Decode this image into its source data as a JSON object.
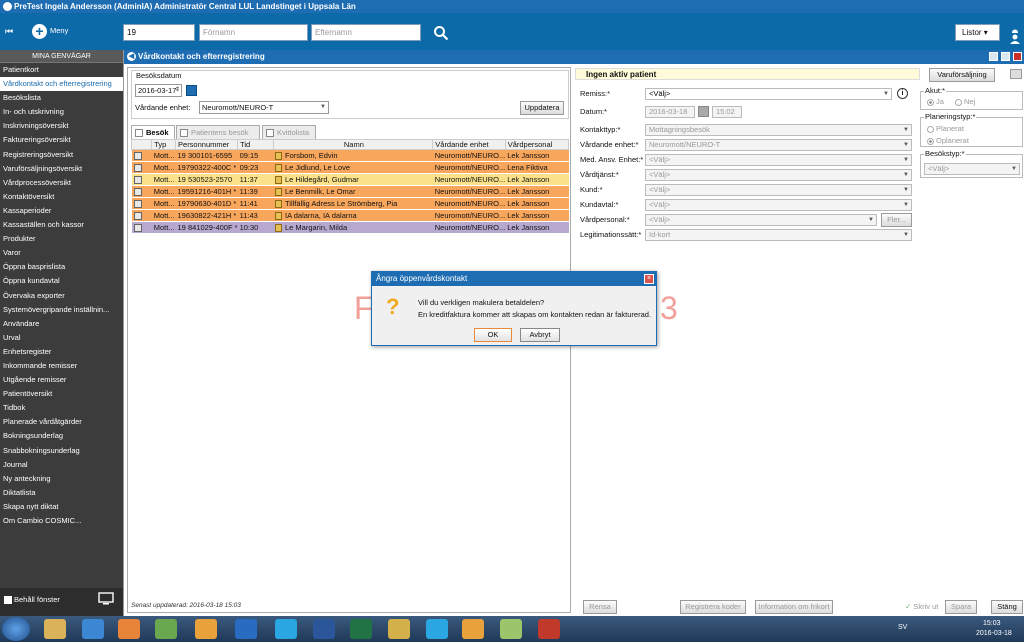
{
  "window_title": "PreTest Ingela Andersson (AdminIA) Administratör Central LUL Landstinget i Uppsala Län",
  "header": {
    "menu_label": "Meny",
    "search_value": "19",
    "firstname_placeholder": "Förnamn",
    "lastname_placeholder": "Efternamn",
    "lists_label": "Listor"
  },
  "sidebar": {
    "title": "MINA GENVÄGAR",
    "items": [
      "Patientkort",
      "Vårdkontakt och efterregistrering",
      "Besökslista",
      "In- och utskrivning",
      "Inskrivningsöversikt",
      "Faktureringsöversikt",
      "Registreringsöversikt",
      "Varuförsäljningsöversikt",
      "Vårdprocessöversikt",
      "Kontaktöversikt",
      "Kassaperioder",
      "Kassaställen och kassor",
      "Produkter",
      "Varor",
      "Öppna basprislista",
      "Öppna kundavtal",
      "Övervaka exporter",
      "Systemövergripande inställnin...",
      "Användare",
      "Urval",
      "Enhetsregister",
      "Inkommande remisser",
      "Utgående remisser",
      "Patientöversikt",
      "Tidbok",
      "Planerade vårdåtgärder",
      "Bokningsunderlag",
      "Snabbokningsunderlag",
      "Journal",
      "Ny anteckning",
      "Diktatlista",
      "Skapa nytt diktat",
      "Om Cambio COSMIC..."
    ],
    "active_index": 1,
    "keep_window_label": "Behåll fönster"
  },
  "main": {
    "title": "Vårdkontakt och efterregistrering",
    "besok_group_label": "Besöksdatum",
    "date_value": "2016-03-17",
    "unit_label": "Vårdande enhet:",
    "unit_value": "Neuromott/NEURO-T",
    "update_button": "Uppdatera",
    "tabs": [
      "Besök",
      "Patientens besök",
      "Kvittolista"
    ],
    "columns": [
      "Typ",
      "Personnummer",
      "Tid",
      "Namn",
      "Vårdande enhet",
      "Vårdpersonal"
    ],
    "rows": [
      {
        "typ": "Mott...",
        "pnr": "19 300101-6595",
        "tid": "09:15",
        "namn": "Forsbom, Edvin",
        "enhet": "Neuromott/NEURO...",
        "personal": "Lek Jansson",
        "color": "orange"
      },
      {
        "typ": "Mott...",
        "pnr": "19790322-400C *",
        "tid": "09:23",
        "namn": "Le Jidlund, Le Love",
        "enhet": "Neuromott/NEURO...",
        "personal": "Lena Fiktiva",
        "color": "orange"
      },
      {
        "typ": "Mott...",
        "pnr": "19 530523-2570",
        "tid": "11:37",
        "namn": "Le Hildegård, Gudmar",
        "enhet": "Neuromott/NEURO...",
        "personal": "Lek Jansson",
        "color": "yellow"
      },
      {
        "typ": "Mott...",
        "pnr": "19591216-401H *",
        "tid": "11:39",
        "namn": "Le Benmilk, Le Omar",
        "enhet": "Neuromott/NEURO...",
        "personal": "Lek Jansson",
        "color": "orange"
      },
      {
        "typ": "Mott...",
        "pnr": "19790630-401D *",
        "tid": "11:41",
        "namn": "Tillfällig Adress Le Strömberg, Pia",
        "enhet": "Neuromott/NEURO...",
        "personal": "Lek Jansson",
        "color": "orange"
      },
      {
        "typ": "Mott...",
        "pnr": "19630822-421H *",
        "tid": "11:43",
        "namn": "IA dalarna, IA dalarna",
        "enhet": "Neuromott/NEURO...",
        "personal": "Lek Jansson",
        "color": "orange"
      },
      {
        "typ": "Mott...",
        "pnr": "19 841029-400F *",
        "tid": "10:30",
        "namn": "Le Margarin, Milda",
        "enhet": "Neuromott/NEURO...",
        "personal": "Lek Jansson",
        "color": "purple"
      }
    ],
    "status_text": "Senast uppdaterad: 2016-03-18 15:03"
  },
  "right": {
    "no_patient": "Ingen aktiv patient",
    "sales_button": "Varuförsäljning",
    "remiss_label": "Remiss:*",
    "remiss_value": "<Välj>",
    "datum_label": "Datum:*",
    "datum_value": "2016-03-18",
    "time_value": "15:02",
    "kontakttyp_label": "Kontakttyp:*",
    "kontakttyp_value": "Mottagningsbesök",
    "enhet_label": "Vårdande enhet:*",
    "enhet_value": "Neuromott/NEURO-T",
    "medansv_label": "Med. Ansv. Enhet:*",
    "medansv_value": "<Välj>",
    "vardtjanst_label": "Vårdtjänst:*",
    "vardtjanst_value": "<Välj>",
    "kund_label": "Kund:*",
    "kund_value": "<Välj>",
    "kundavtal_label": "Kundavtal:*",
    "kundavtal_value": "<Välj>",
    "vardpersonal_label": "Vårdpersonal:*",
    "vardpersonal_value": "<Välj>",
    "fler_label": "Fler...",
    "legit_label": "Legitimationssätt:*",
    "legit_value": "Id-kort",
    "akut_label": "Akut:*",
    "ja": "Ja",
    "nej": "Nej",
    "planering_label": "Planeringstyp:*",
    "planerat": "Planerat",
    "oplanerat": "Oplanerat",
    "besokstyp_label": "Besökstyp:*",
    "besokstyp_value": "<Välj>",
    "bottom_buttons": [
      "Rensa",
      "Registrera koder",
      "Information om frikort"
    ],
    "print_label": "Skriv ut",
    "save_label": "Spara",
    "close_label": "Stäng"
  },
  "watermark": {
    "left": "F",
    "right": "3"
  },
  "dialog": {
    "title": "Ångra öppenvårdskontakt",
    "message1": "Vill du verkligen makulera betaldelen?",
    "message2": "En kreditfaktura kommer att skapas om kontakten redan är fakturerad.",
    "ok": "OK",
    "cancel": "Avbryt"
  },
  "taskbar": {
    "lang": "SV",
    "time": "15:03",
    "date": "2016-03-18"
  }
}
